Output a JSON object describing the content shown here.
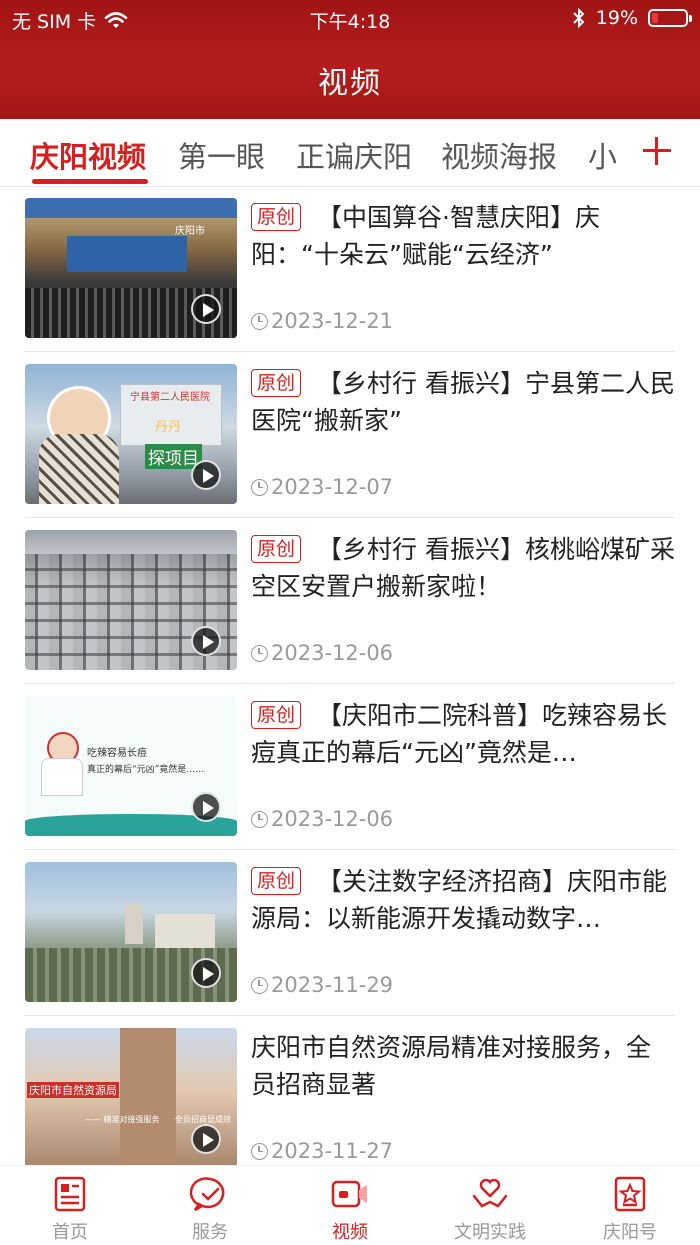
{
  "status_bar": {
    "carrier": "无 SIM 卡",
    "time": "下午4:18",
    "battery": "19%",
    "battery_level": 0.19
  },
  "header": {
    "title": "视频"
  },
  "tabs": [
    {
      "label": "庆阳视频",
      "active": true
    },
    {
      "label": "第一眼"
    },
    {
      "label": "正谝庆阳"
    },
    {
      "label": "视频海报"
    },
    {
      "label": "小"
    }
  ],
  "news": [
    {
      "badge": "原创",
      "title": "【中国算谷·智慧庆阳】庆阳：“十朵云”赋能“云经济”",
      "date": "2023-12-21"
    },
    {
      "badge": "原创",
      "title": "【乡村行 看振兴】宁县第二人民医院“搬新家”",
      "date": "2023-12-07"
    },
    {
      "badge": "原创",
      "title": "【乡村行 看振兴】核桃峪煤矿采空区安置户搬新家啦！",
      "date": "2023-12-06"
    },
    {
      "badge": "原创",
      "title": "【庆阳市二院科普】吃辣容易长痘真正的幕后“元凶”竟然是…",
      "date": "2023-12-06"
    },
    {
      "badge": "原创",
      "title": "【关注数字经济招商】庆阳市能源局：以新能源开发撬动数字…",
      "date": "2023-11-29"
    },
    {
      "badge": "",
      "title": "庆阳市自然资源局精准对接服务，全员招商显著",
      "date": "2023-11-27"
    }
  ],
  "thumb_text": {
    "t1_caption": "庆阳市",
    "t2_hospital": "宁县第二人民医院",
    "t2_label_a": "丹丹",
    "t2_label_b": "探项目",
    "t4_line1": "吃辣容易长痘",
    "t4_line2": "真正的幕后“元凶”竟然是……",
    "t6_sign": "庆阳市自然资源局",
    "t6_sub": "—— 精准对接强服务",
    "t6_sub2": "全员招商显成效"
  },
  "bottom_nav": [
    {
      "label": "首页",
      "icon": "home-news-icon"
    },
    {
      "label": "服务",
      "icon": "service-chat-icon"
    },
    {
      "label": "视频",
      "icon": "video-camera-icon",
      "active": true
    },
    {
      "label": "文明实践",
      "icon": "heart-hands-icon"
    },
    {
      "label": "庆阳号",
      "icon": "star-badge-icon"
    }
  ],
  "colors": {
    "brand_red": "#d81e1e",
    "header_red": "#ad1818",
    "muted": "#999999"
  }
}
